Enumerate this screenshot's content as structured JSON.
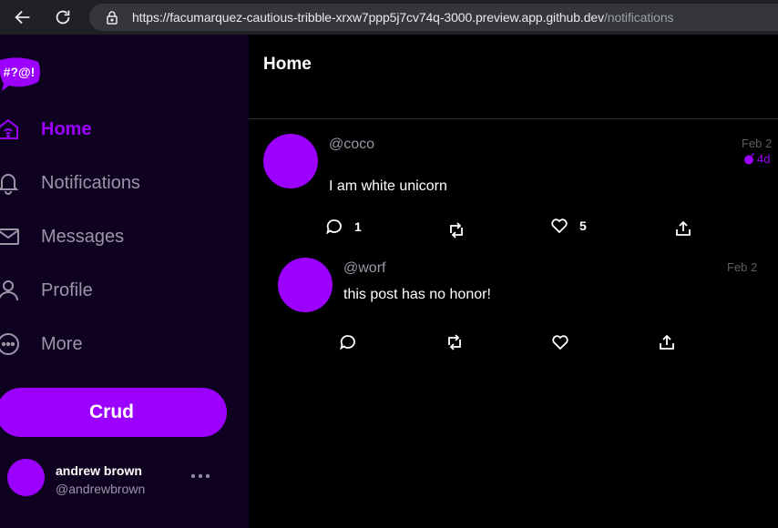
{
  "browser": {
    "url_host": "https://facumarquez-cautious-tribble-xrxw7ppp5j7cv74q-3000.preview.app.github.dev",
    "url_path": "/notifications"
  },
  "sidebar": {
    "logo_text": "#?@!",
    "items": [
      {
        "label": "Home",
        "icon": "home-icon",
        "active": true
      },
      {
        "label": "Notifications",
        "icon": "bell-icon",
        "active": false
      },
      {
        "label": "Messages",
        "icon": "envelope-icon",
        "active": false
      },
      {
        "label": "Profile",
        "icon": "person-icon",
        "active": false
      },
      {
        "label": "More",
        "icon": "more-circle-icon",
        "active": false
      }
    ],
    "crud_label": "Crud",
    "profile": {
      "name": "andrew brown",
      "handle": "@andrewbrown"
    }
  },
  "main": {
    "title": "Home",
    "posts": [
      {
        "handle": "@coco",
        "date": "Feb 2",
        "expires": "4d",
        "message": "I am white unicorn",
        "replies": "1",
        "likes": "5"
      },
      {
        "handle": "@worf",
        "date": "Feb 2",
        "message": "this post has no honor!",
        "replies": "",
        "likes": ""
      }
    ]
  },
  "colors": {
    "accent": "#9c00ff",
    "sidebar_bg": "#0f0220",
    "main_bg": "#000000",
    "muted_text": "#9b96a6"
  }
}
